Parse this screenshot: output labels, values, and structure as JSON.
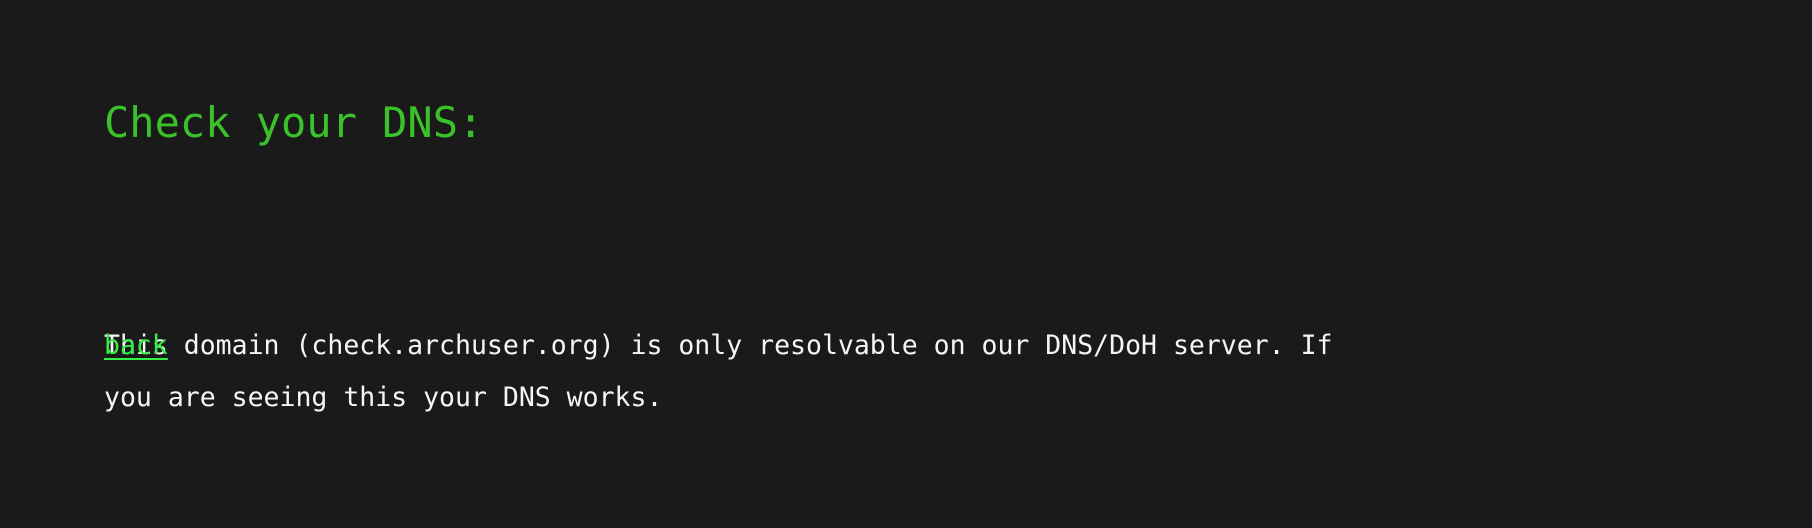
{
  "page": {
    "background_color": "#1a1a1a",
    "heading": {
      "text": "Check your DNS:",
      "color": "#3ac22a"
    },
    "body": {
      "color": "#f5f5f5",
      "full_text": "This domain (check.archuser.org) is only resolvable on our DNS/DoH server. If you are seeing this your DNS works.",
      "lines": [
        "This domain (check.archuser.org) is only resolvable on our DNS/DoH server. If",
        "you are seeing this your DNS works."
      ],
      "domain": "check.archuser.org"
    },
    "link": {
      "label": "back",
      "color": "#33ee44"
    }
  }
}
